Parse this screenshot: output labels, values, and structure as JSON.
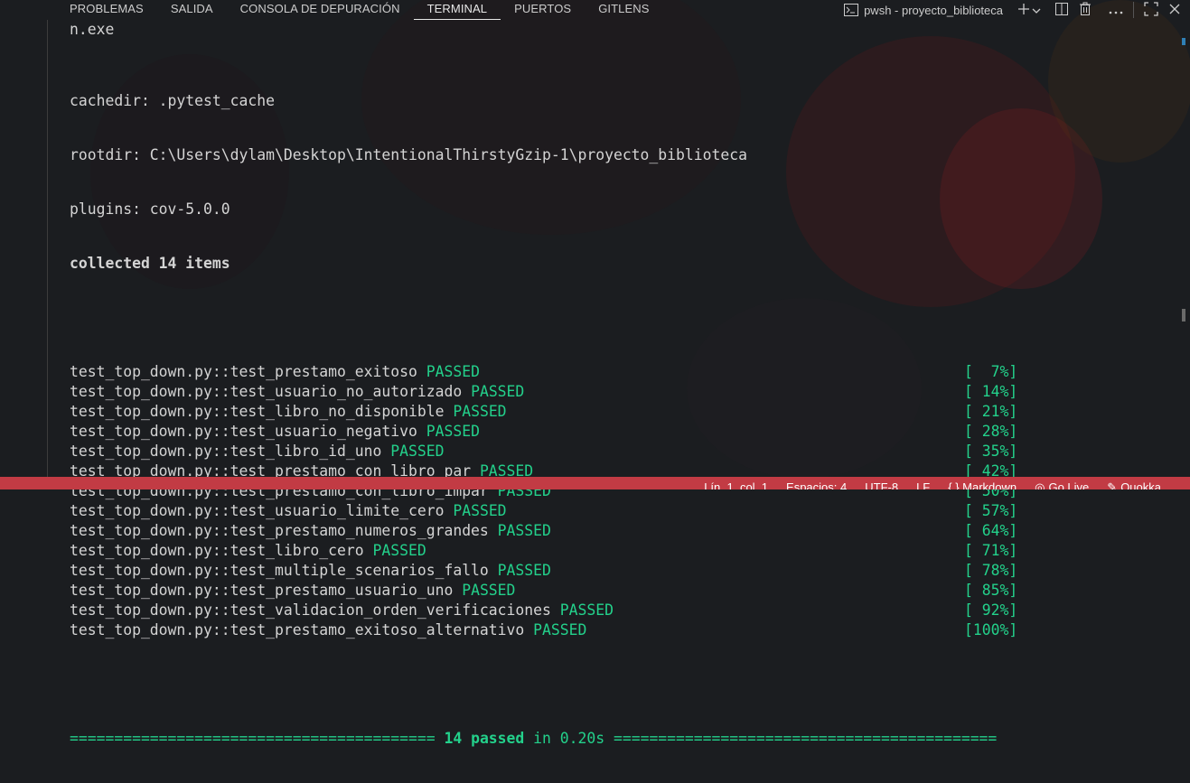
{
  "panel": {
    "tabs": [
      {
        "label": "PROBLEMAS"
      },
      {
        "label": "SALIDA"
      },
      {
        "label": "CONSOLA DE DEPURACIÓN"
      },
      {
        "label": "TERMINAL",
        "active": true
      },
      {
        "label": "PUERTOS"
      },
      {
        "label": "GITLENS"
      }
    ],
    "terminal_name": "pwsh - proyecto_biblioteca",
    "icons": [
      "terminal-icon",
      "plus-icon",
      "chevron-down-icon",
      "split-icon",
      "trash-icon",
      "more-icon",
      "maximize-icon",
      "close-icon"
    ]
  },
  "terminal": {
    "header_lines": [
      "n.exe",
      "cachedir: .pytest_cache",
      "rootdir: C:\\Users\\dylam\\Desktop\\IntentionalThirstyGzip-1\\proyecto_biblioteca",
      "plugins: cov-5.0.0"
    ],
    "collected": "collected 14 items",
    "tests": [
      {
        "name": "test_top_down.py::test_prestamo_exitoso",
        "status": "PASSED",
        "pct": "[  7%]"
      },
      {
        "name": "test_top_down.py::test_usuario_no_autorizado",
        "status": "PASSED",
        "pct": "[ 14%]"
      },
      {
        "name": "test_top_down.py::test_libro_no_disponible",
        "status": "PASSED",
        "pct": "[ 21%]"
      },
      {
        "name": "test_top_down.py::test_usuario_negativo",
        "status": "PASSED",
        "pct": "[ 28%]"
      },
      {
        "name": "test_top_down.py::test_libro_id_uno",
        "status": "PASSED",
        "pct": "[ 35%]"
      },
      {
        "name": "test_top_down.py::test_prestamo_con_libro_par",
        "status": "PASSED",
        "pct": "[ 42%]"
      },
      {
        "name": "test_top_down.py::test_prestamo_con_libro_impar",
        "status": "PASSED",
        "pct": "[ 50%]"
      },
      {
        "name": "test_top_down.py::test_usuario_limite_cero",
        "status": "PASSED",
        "pct": "[ 57%]"
      },
      {
        "name": "test_top_down.py::test_prestamo_numeros_grandes",
        "status": "PASSED",
        "pct": "[ 64%]"
      },
      {
        "name": "test_top_down.py::test_libro_cero",
        "status": "PASSED",
        "pct": "[ 71%]"
      },
      {
        "name": "test_top_down.py::test_multiple_scenarios_fallo",
        "status": "PASSED",
        "pct": "[ 78%]"
      },
      {
        "name": "test_top_down.py::test_prestamo_usuario_uno",
        "status": "PASSED",
        "pct": "[ 85%]"
      },
      {
        "name": "test_top_down.py::test_validacion_orden_verificaciones",
        "status": "PASSED",
        "pct": "[ 92%]"
      },
      {
        "name": "test_top_down.py::test_prestamo_exitoso_alternativo",
        "status": "PASSED",
        "pct": "[100%]"
      }
    ],
    "summary_left": "========================================= ",
    "summary_mid": "14 passed",
    "summary_time": " in 0.20s ",
    "summary_right": "==========================================="
  },
  "statusbar": {
    "items": [
      "Lín. 1, col. 1",
      "Espacios: 4",
      "UTF-8",
      "LF",
      "{ } Markdown",
      "Go Live",
      "Quokka"
    ]
  },
  "colors": {
    "pass": "#23d18b",
    "statusbar": "#c23b44",
    "background": "#1b1d20"
  }
}
